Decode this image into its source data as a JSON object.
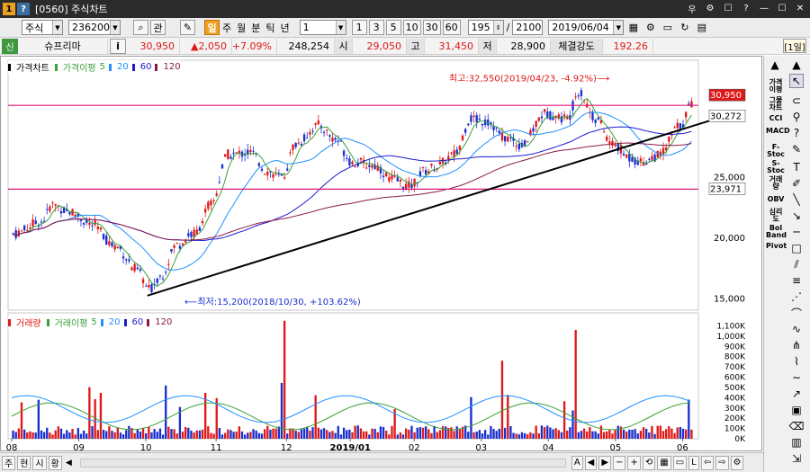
{
  "window": {
    "badge_one": "1",
    "badge_help": "?",
    "title": "[0560] 주식차트",
    "controls": [
      "우",
      "⚙",
      "☐",
      "?",
      "—",
      "☐",
      "✕"
    ]
  },
  "toolbar": {
    "market": "주식",
    "code": "236200",
    "search_icon": "⌕",
    "gwan": "관",
    "period_il": "일",
    "periods": [
      "주",
      "월",
      "분",
      "틱",
      "년"
    ],
    "interval_value": "1",
    "intervals": [
      "1",
      "3",
      "5",
      "10",
      "30",
      "60"
    ],
    "count": "195",
    "slash": "/",
    "total": "2100",
    "date": "2019/06/04",
    "icons": [
      "calendar-icon",
      "settings-icon",
      "screen-icon",
      "refresh-icon",
      "grid-icon"
    ]
  },
  "quote": {
    "badge": "신",
    "name": "슈프리마",
    "info_btn": "i",
    "price": "30,950",
    "change": "▲2,050",
    "change_pct": "+7.09%",
    "volume": "248,254",
    "open_label": "시",
    "open": "29,050",
    "high_label": "고",
    "high": "31,450",
    "low_label": "저",
    "low": "28,900",
    "strength_label": "체결강도",
    "strength": "192.26",
    "period_tag": "[1일]"
  },
  "price_panel": {
    "legend_title": "가격차트",
    "legend_ma": "가격이평",
    "ma_values": [
      "5",
      "20",
      "60",
      "120"
    ],
    "ma_colors": [
      "#3aa03a",
      "#1e90ff",
      "#1a1acc",
      "#8b1a4a"
    ],
    "yticks": [
      "25,000",
      "20,000",
      "15,000"
    ],
    "annot_high": "최고:32,550(2019/04/23, -4.92%)⟶",
    "annot_low": "⟵최저:15,200(2018/10/30, +103.62%)",
    "last_price_tag": "30,950",
    "ma_tag": "30,272",
    "line_tag": "23,971"
  },
  "volume_panel": {
    "legend_title": "거래량",
    "legend_ma": "거래이평",
    "ma_values": [
      "5",
      "20",
      "60",
      "120"
    ],
    "yticks": [
      "1,100K",
      "1,000K",
      "900K",
      "800K",
      "700K",
      "600K",
      "500K",
      "400K",
      "300K",
      "200K",
      "100K",
      "0K"
    ]
  },
  "xaxis": {
    "labels": [
      "08",
      "09",
      "10",
      "11",
      "12",
      "2019/01",
      "02",
      "03",
      "04",
      "05",
      "06"
    ]
  },
  "sidebar": {
    "text_items": [
      "가격이평",
      "그물차트",
      "CCI",
      "MACD",
      "F-Stoc",
      "S-Stoc",
      "거래량",
      "OBV",
      "심리도",
      "Bol Band",
      "Pivot"
    ]
  },
  "bottom": {
    "tabs": [
      "주",
      "현",
      "시",
      "황"
    ],
    "nav": [
      "A",
      "◀",
      "▶",
      "−",
      "+"
    ]
  },
  "colors": {
    "up": "#e01818",
    "down": "#1a2fd0",
    "hline": "#e0157a",
    "trend": "#000000"
  }
}
